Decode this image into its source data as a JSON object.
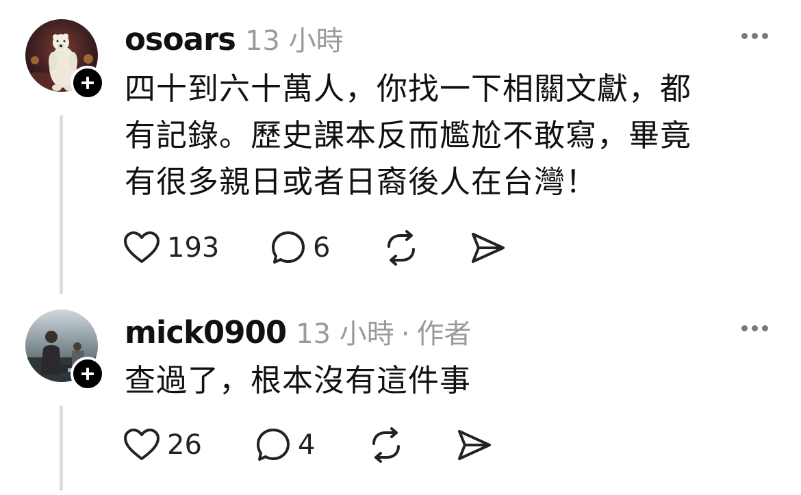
{
  "posts": [
    {
      "username": "osoars",
      "time": "13 小時",
      "author_tag": "",
      "lines": [
        "四十到六十萬人，你找一下相關文獻，都",
        "有記錄。歷史課本反而尷尬不敢寫，畢竟",
        "有很多親日或者日裔後人在台灣！"
      ],
      "likes": "193",
      "replies": "6"
    },
    {
      "username": "mick0900",
      "time": "13 小時",
      "separator": "·",
      "author_tag": "作者",
      "lines": [
        "查過了，根本沒有這件事"
      ],
      "likes": "26",
      "replies": "4"
    }
  ],
  "icons": {
    "like": "heart-icon",
    "reply": "comment-icon",
    "repost": "repost-icon",
    "share": "send-icon",
    "more": "more-icon",
    "follow": "plus-icon"
  }
}
